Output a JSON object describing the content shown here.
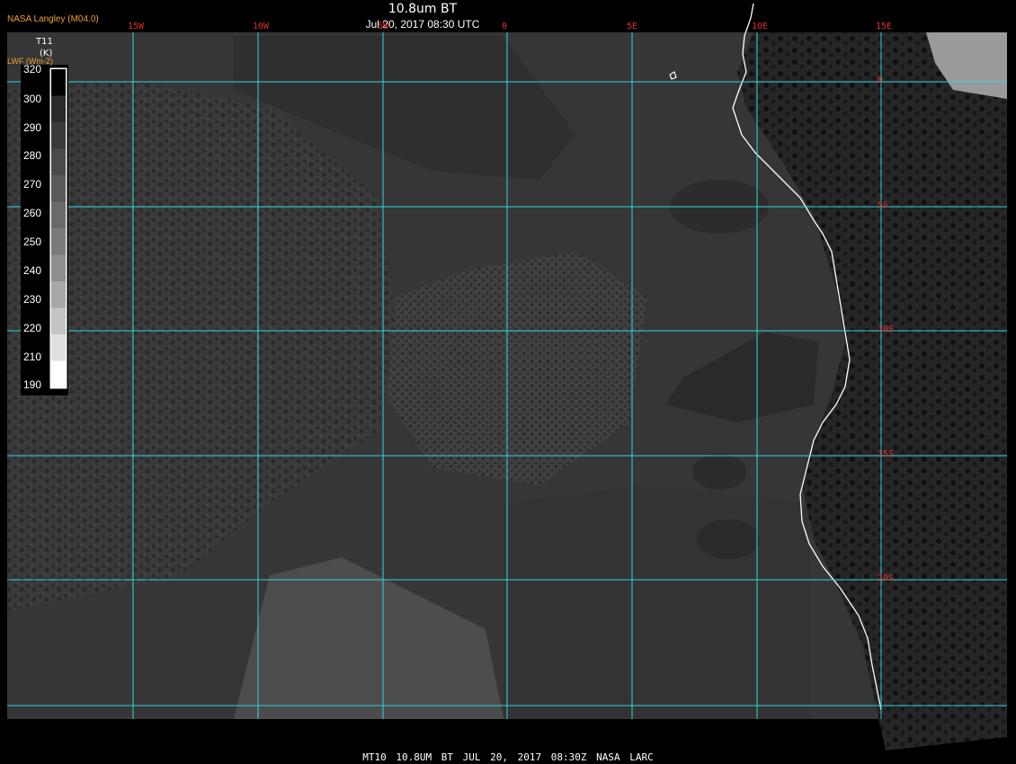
{
  "header": {
    "provider": "NASA Langley (M04.0)",
    "title": "10.8um BT",
    "subtitle": "Jul 20, 2017 08:30 UTC"
  },
  "legend": {
    "title_line1": "T11",
    "title_line2": "(K)",
    "alt_label": "LWF (Wm-2)",
    "ticks": [
      "320",
      "300",
      "290",
      "280",
      "270",
      "260",
      "250",
      "240",
      "230",
      "220",
      "210",
      "190"
    ],
    "gradient": [
      "#000000",
      "#2a2a2a",
      "#3a3a3a",
      "#4a4a4a",
      "#5a5a5a",
      "#6a6a6a",
      "#7a7a7a",
      "#8e8e8e",
      "#a8a8a8",
      "#c4c4c4",
      "#e0e0e0",
      "#ffffff"
    ]
  },
  "grid": {
    "color": "#2fd6e0",
    "label_color": "#e03030",
    "longitudes": [
      "15W",
      "10W",
      "5W",
      "0",
      "5E",
      "10E",
      "15E"
    ],
    "latitudes": [
      "0",
      "5S",
      "10S",
      "15S",
      "20S"
    ]
  },
  "footer": {
    "text": "MT10  10.8UM BT   JUL 20, 2017 08:30Z  NASA LARC"
  },
  "colors": {
    "ocean_dark": "#2e2e2e",
    "ocean_mid": "#3c3c3c",
    "cloud_light": "#555555",
    "coastline": "#ffffff"
  }
}
